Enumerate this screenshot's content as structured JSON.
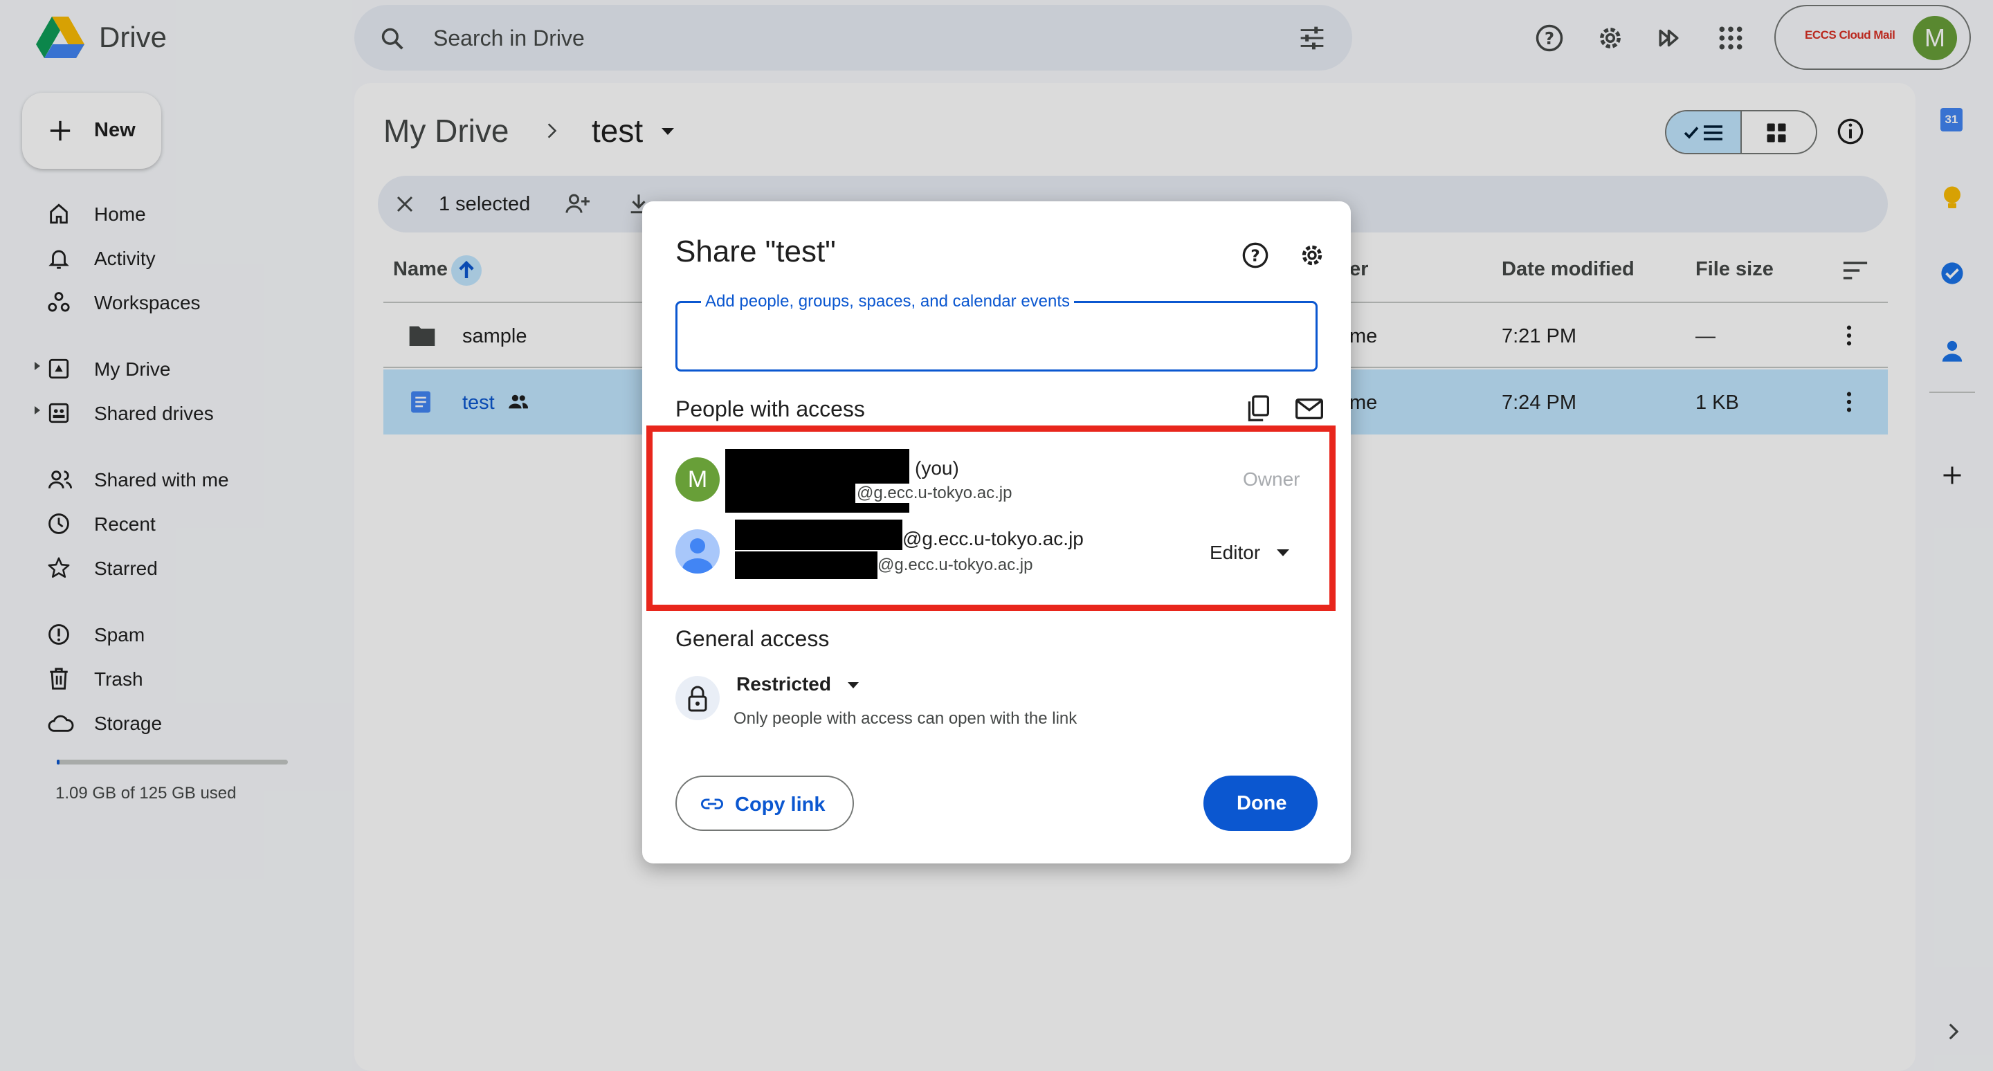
{
  "app": {
    "name": "Drive",
    "account_chip": "ECCS Cloud Mail",
    "avatar_letter": "M"
  },
  "search": {
    "placeholder": "Search in Drive"
  },
  "sidebar": {
    "new_label": "New",
    "items": [
      {
        "label": "Home",
        "icon": "home-icon"
      },
      {
        "label": "Activity",
        "icon": "bell-icon"
      },
      {
        "label": "Workspaces",
        "icon": "workspaces-icon"
      },
      {
        "label": "My Drive",
        "icon": "my-drive-icon"
      },
      {
        "label": "Shared drives",
        "icon": "shared-drives-icon"
      },
      {
        "label": "Shared with me",
        "icon": "people-icon"
      },
      {
        "label": "Recent",
        "icon": "clock-icon"
      },
      {
        "label": "Starred",
        "icon": "star-icon"
      },
      {
        "label": "Spam",
        "icon": "spam-icon"
      },
      {
        "label": "Trash",
        "icon": "trash-icon"
      },
      {
        "label": "Storage",
        "icon": "cloud-icon"
      }
    ],
    "storage_text": "1.09 GB of 125 GB used",
    "storage_fraction": 0.0087
  },
  "breadcrumb": {
    "root": "My Drive",
    "current": "test"
  },
  "toolbar": {
    "selected_text": "1 selected"
  },
  "table": {
    "headers": {
      "name": "Name",
      "owner": "er",
      "date": "Date modified",
      "size": "File size"
    },
    "rows": [
      {
        "name": "sample",
        "owner": "me",
        "date": "7:21 PM",
        "size": "—",
        "type": "folder",
        "selected": false
      },
      {
        "name": "test",
        "owner": "me",
        "date": "7:24 PM",
        "size": "1 KB",
        "type": "doc",
        "selected": true
      }
    ]
  },
  "dialog": {
    "title": "Share \"test\"",
    "input_label": "Add people, groups, spaces, and calendar events",
    "people_title": "People with access",
    "people": [
      {
        "avatar": "M",
        "name_suffix": "(you)",
        "email": "@g.ecc.u-tokyo.ac.jp",
        "role": "Owner"
      },
      {
        "avatar": "",
        "name_suffix": "@g.ecc.u-tokyo.ac.jp",
        "email": "@g.ecc.u-tokyo.ac.jp",
        "role": "Editor"
      }
    ],
    "general_title": "General access",
    "access_level": "Restricted",
    "access_desc": "Only people with access can open with the link",
    "copy_link": "Copy link",
    "done": "Done"
  },
  "colors": {
    "accent": "#0b57d0",
    "highlight": "#e8261c",
    "selected_row": "#c2e7ff",
    "owner_avatar": "#689f38"
  }
}
